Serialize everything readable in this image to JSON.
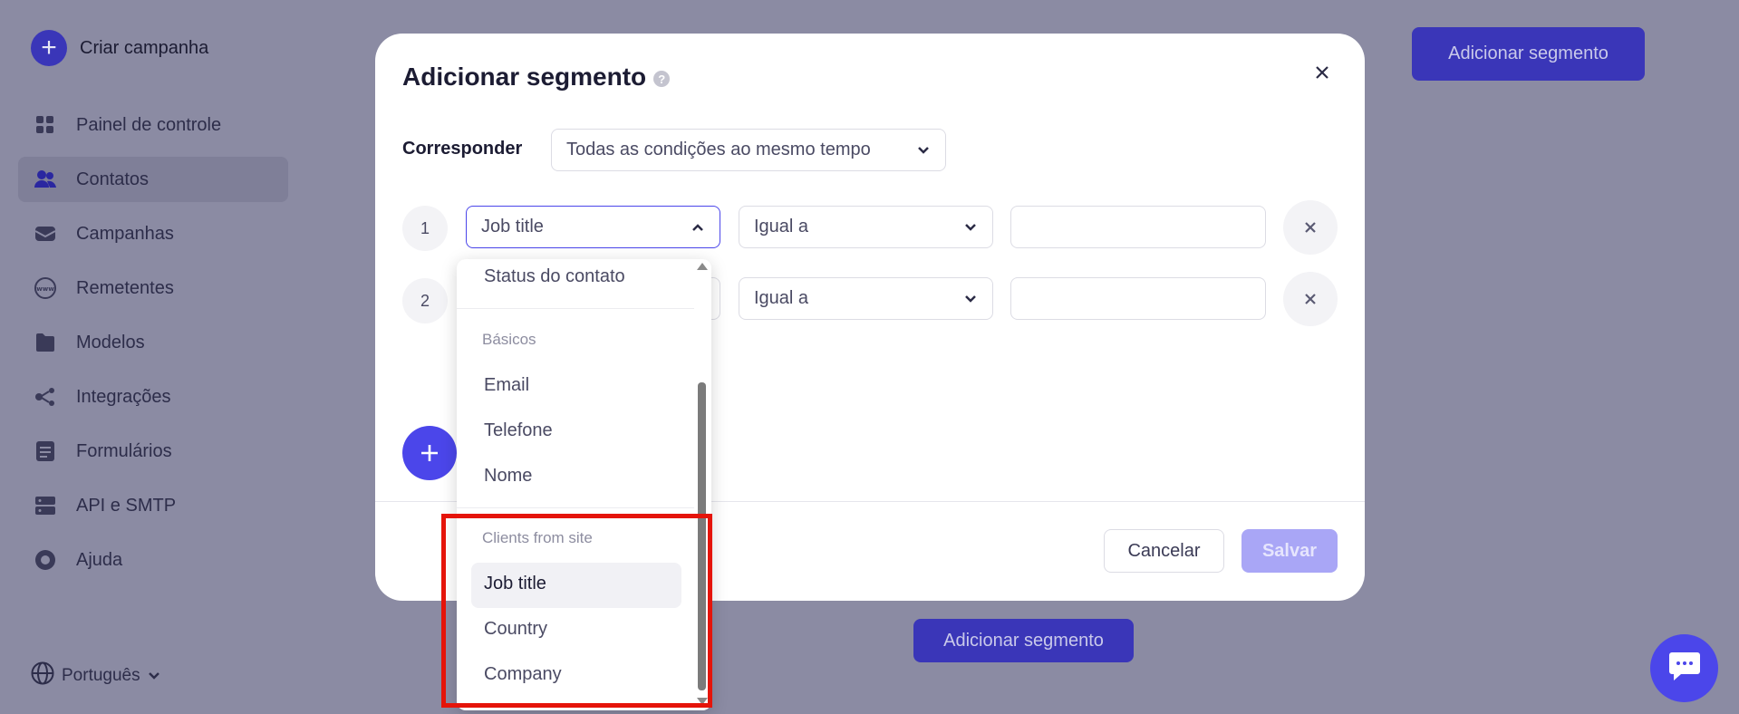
{
  "sidebar": {
    "create_label": "Criar campanha",
    "items": [
      {
        "label": "Painel de controle",
        "icon": "dashboard-icon"
      },
      {
        "label": "Contatos",
        "icon": "contacts-icon",
        "active": true
      },
      {
        "label": "Campanhas",
        "icon": "campaigns-icon"
      },
      {
        "label": "Remetentes",
        "icon": "www-icon"
      },
      {
        "label": "Modelos",
        "icon": "templates-icon"
      },
      {
        "label": "Integrações",
        "icon": "integrations-icon"
      },
      {
        "label": "Formulários",
        "icon": "forms-icon"
      },
      {
        "label": "API e SMTP",
        "icon": "server-icon"
      },
      {
        "label": "Ajuda",
        "icon": "lifebuoy-icon"
      }
    ],
    "language": "Português"
  },
  "page": {
    "add_segment_top": "Adicionar segmento",
    "add_segment_bottom": "Adicionar segmento"
  },
  "modal": {
    "title": "Adicionar segmento",
    "match_label": "Corresponder",
    "match_value": "Todas as condições ao mesmo tempo",
    "conditions": [
      {
        "number": "1",
        "field": "Job title",
        "operator": "Igual a",
        "value": ""
      },
      {
        "number": "2",
        "field": "",
        "operator": "Igual a",
        "value": ""
      }
    ],
    "cancel_label": "Cancelar",
    "save_label": "Salvar"
  },
  "dropdown": {
    "top_item": "Status do contato",
    "groups": [
      {
        "name": "Básicos",
        "items": [
          "Email",
          "Telefone",
          "Nome"
        ]
      },
      {
        "name": "Clients from site",
        "items": [
          "Job title",
          "Country",
          "Company"
        ]
      }
    ],
    "selected": "Job title"
  },
  "colors": {
    "accent": "#4b46ea",
    "highlight": "#e5140a",
    "overlay_bg": "#8b8ba3"
  }
}
